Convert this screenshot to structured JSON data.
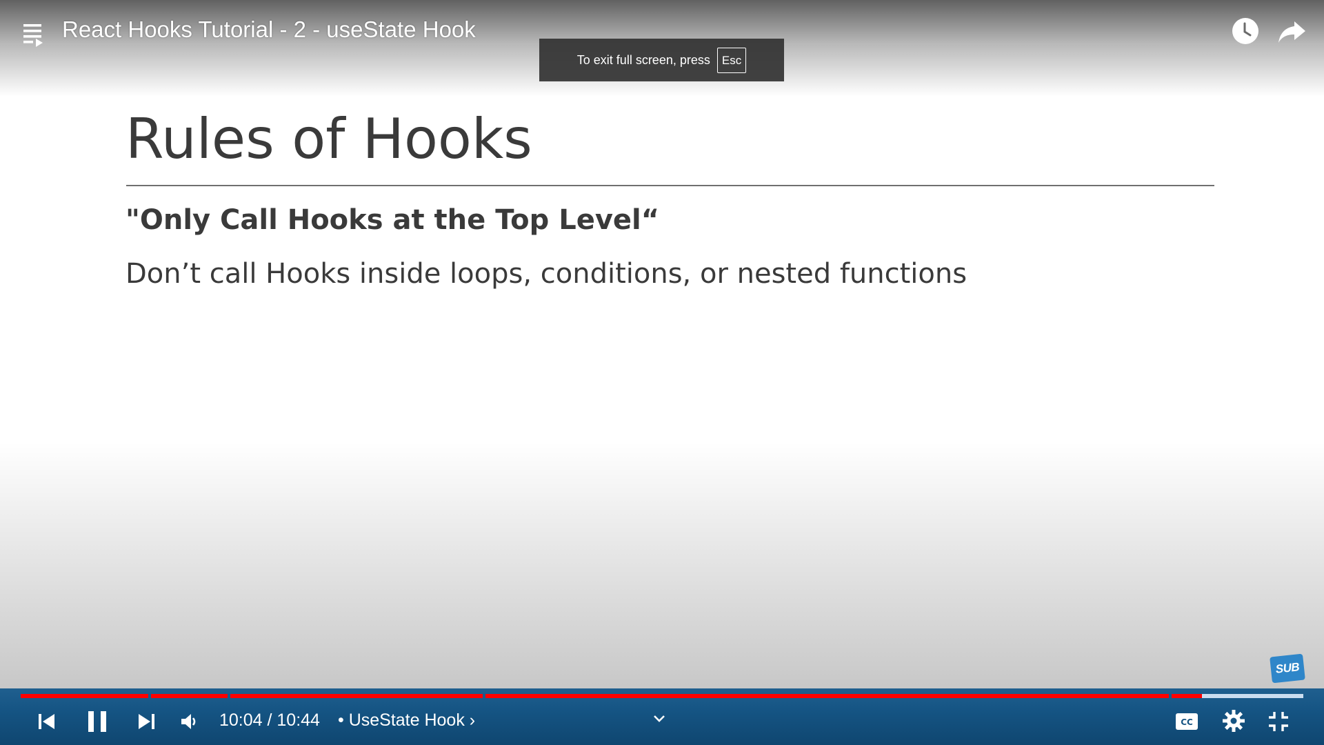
{
  "top_bar": {
    "video_title": "React Hooks Tutorial - 2 - useState Hook"
  },
  "toast": {
    "message": "To exit full screen, press",
    "key": "Esc"
  },
  "slide": {
    "title": "Rules of Hooks",
    "subheading": "\"Only Call Hooks at the Top Level“",
    "body": "Don’t call Hooks inside loops, conditions, or nested functions"
  },
  "badge": {
    "label": "SUB"
  },
  "controls": {
    "time": "10:04 / 10:44",
    "chapter": "• UseState Hook ›",
    "progress_fraction": 0.9208,
    "accent_color": "#ff0000",
    "bar_color": "#155483"
  },
  "icons": {
    "playlist": "playlist-icon",
    "watch_later": "clock-icon",
    "share": "share-arrow-icon",
    "prev": "skip-previous-icon",
    "pause": "pause-icon",
    "next": "skip-next-icon",
    "volume": "volume-icon",
    "chevron": "chevron-down-icon",
    "cc": "closed-captions-icon",
    "settings": "gear-icon",
    "exit_fullscreen": "exit-fullscreen-icon"
  }
}
